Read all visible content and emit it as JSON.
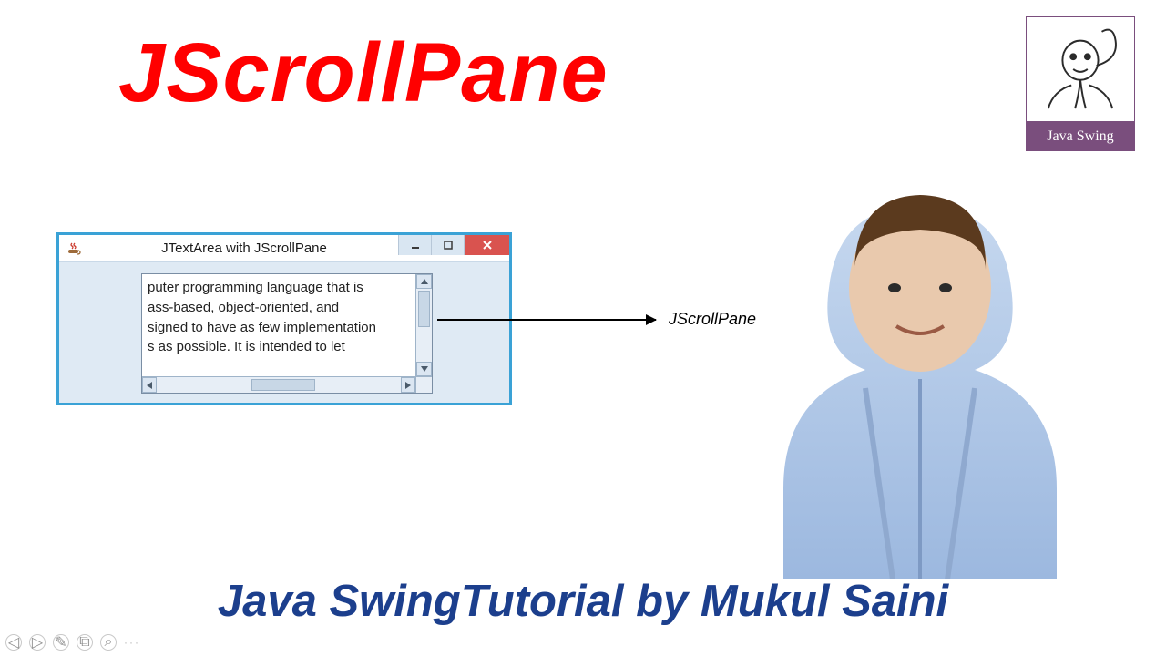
{
  "title": "JScrollPane",
  "logo": {
    "label": "Java Swing"
  },
  "window": {
    "title": "JTextArea with JScrollPane",
    "textarea_lines": [
      "puter programming language that is",
      "ass-based, object-oriented, and",
      "signed to have as few implementation",
      "s as possible. It is intended to let"
    ]
  },
  "annotation": {
    "label": "JScrollPane"
  },
  "footer": "Java SwingTutorial by Mukul Saini",
  "slidenav": {
    "prev": "◁",
    "next": "▷",
    "pen": "✎",
    "copy": "⧉",
    "zoom": "⌕",
    "more": "···"
  }
}
